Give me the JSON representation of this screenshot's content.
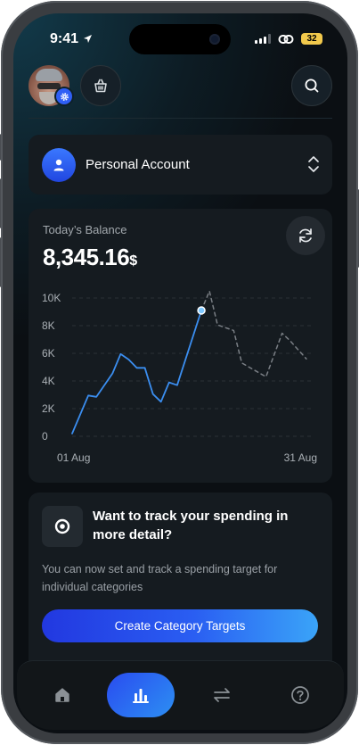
{
  "status_bar": {
    "time": "9:41",
    "battery": "32"
  },
  "header": {
    "avatar_icon": "user-avatar",
    "settings_badge_icon": "gear-icon",
    "basket_icon": "basket-icon",
    "search_icon": "search-icon"
  },
  "account": {
    "label": "Personal Account",
    "icon": "user-icon",
    "chevron_icon": "chevron-up-down-icon"
  },
  "balance": {
    "title": "Today’s Balance",
    "amount": "8,345.16",
    "currency": "$",
    "refresh_icon": "refresh-icon"
  },
  "chart_data": {
    "type": "line",
    "y_ticks": [
      "10K",
      "8K",
      "6K",
      "4K",
      "2K",
      "0"
    ],
    "x_labels": [
      "01 Aug",
      "31 Aug"
    ],
    "ylim": [
      0,
      10000
    ],
    "grid": true,
    "series": [
      {
        "style": "solid",
        "color": "#3b8ef0",
        "x": [
          1,
          3,
          4,
          6,
          7,
          8,
          9,
          10,
          11,
          12,
          13,
          14,
          17
        ],
        "values": [
          200,
          2950,
          2850,
          4550,
          5950,
          5550,
          4950,
          4950,
          3050,
          2500,
          3900,
          3700,
          9100
        ]
      },
      {
        "style": "dashed",
        "color": "#7a7f85",
        "x": [
          17,
          18,
          19,
          21,
          22,
          25,
          27,
          28,
          30
        ],
        "values": [
          9100,
          10500,
          8050,
          7650,
          5300,
          4300,
          7450,
          6900,
          5600
        ]
      }
    ],
    "marker": {
      "x": 17,
      "value": 9100
    }
  },
  "promo": {
    "icon": "target-icon",
    "title": "Want to track your spending in more detail?",
    "description": "You can now set and track a spending target for individual categories",
    "button_label": "Create Category Targets"
  },
  "tab_bar": {
    "items": [
      {
        "name": "home",
        "icon": "home-icon",
        "active": false
      },
      {
        "name": "stats",
        "icon": "bar-chart-icon",
        "active": true
      },
      {
        "name": "transfer",
        "icon": "transfer-icon",
        "active": false
      },
      {
        "name": "help",
        "icon": "help-icon",
        "active": false
      }
    ]
  },
  "colors": {
    "accent": "#2f5ff5",
    "background": "#0b0f13",
    "card": "#151b20",
    "line": "#3b8ef0"
  }
}
